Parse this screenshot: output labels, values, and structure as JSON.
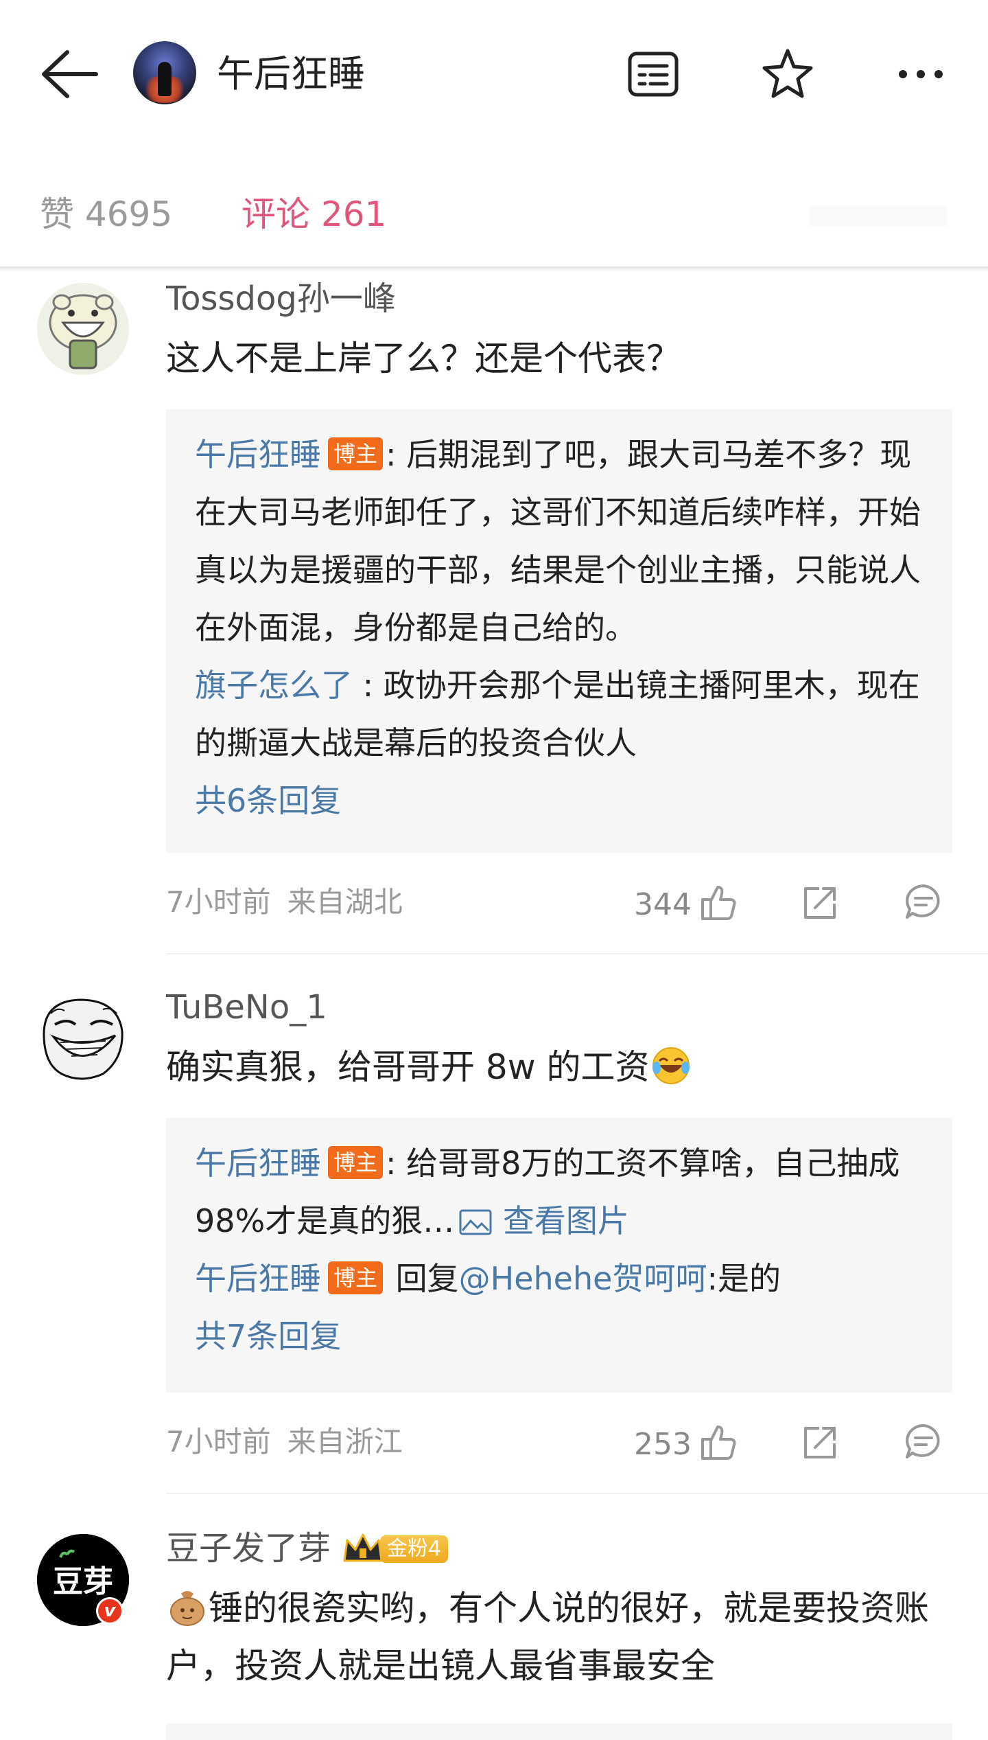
{
  "header": {
    "title": "午后狂睡",
    "icons": [
      "back-arrow-icon",
      "document-icon",
      "star-icon",
      "more-icon"
    ]
  },
  "tabs": {
    "likes_label": "赞",
    "likes_count": "4695",
    "comments_label": "评论",
    "comments_count": "261"
  },
  "comments": [
    {
      "author": "Tossdog孙一峰",
      "text": "这人不是上岸了么？还是个代表？",
      "replies": [
        {
          "author": "午后狂睡",
          "badge": "博主",
          "text": ": 后期混到了吧，跟大司马差不多？现在大司马老师卸任了，这哥们不知道后续咋样，开始真以为是援疆的干部，结果是个创业主播，只能说人在外面混，身份都是自己给的。"
        },
        {
          "author": "旗子怎么了",
          "text": " : 政协开会那个是出镜主播阿里木，现在的撕逼大战是幕后的投资合伙人"
        }
      ],
      "more_replies": "共6条回复",
      "time": "7小时前",
      "location": "来自湖北",
      "likes": "344"
    },
    {
      "author": "TuBeNo_1",
      "text": "确实真狠，给哥哥开 8w 的工资",
      "replies": [
        {
          "author": "午后狂睡",
          "badge": "博主",
          "text": ": 给哥哥8万的工资不算啥，自己抽成98%才是真的狠…",
          "link": "查看图片"
        },
        {
          "author": "午后狂睡",
          "badge": "博主",
          "prefix": " 回复",
          "mention": "@Hehehe贺呵呵",
          "text": ":是的"
        }
      ],
      "more_replies": "共7条回复",
      "time": "7小时前",
      "location": "来自浙江",
      "likes": "253"
    },
    {
      "author": "豆子发了芽",
      "fan_badge": "金粉4",
      "avatar_text": "豆芽",
      "text": "锤的很瓷实哟，有个人说的很好，就是要投资账户，投资人就是出镜人最省事最安全"
    }
  ],
  "colors": {
    "accent": "#e0567a",
    "link": "#4a79a8",
    "badge": "#f26b1a"
  }
}
